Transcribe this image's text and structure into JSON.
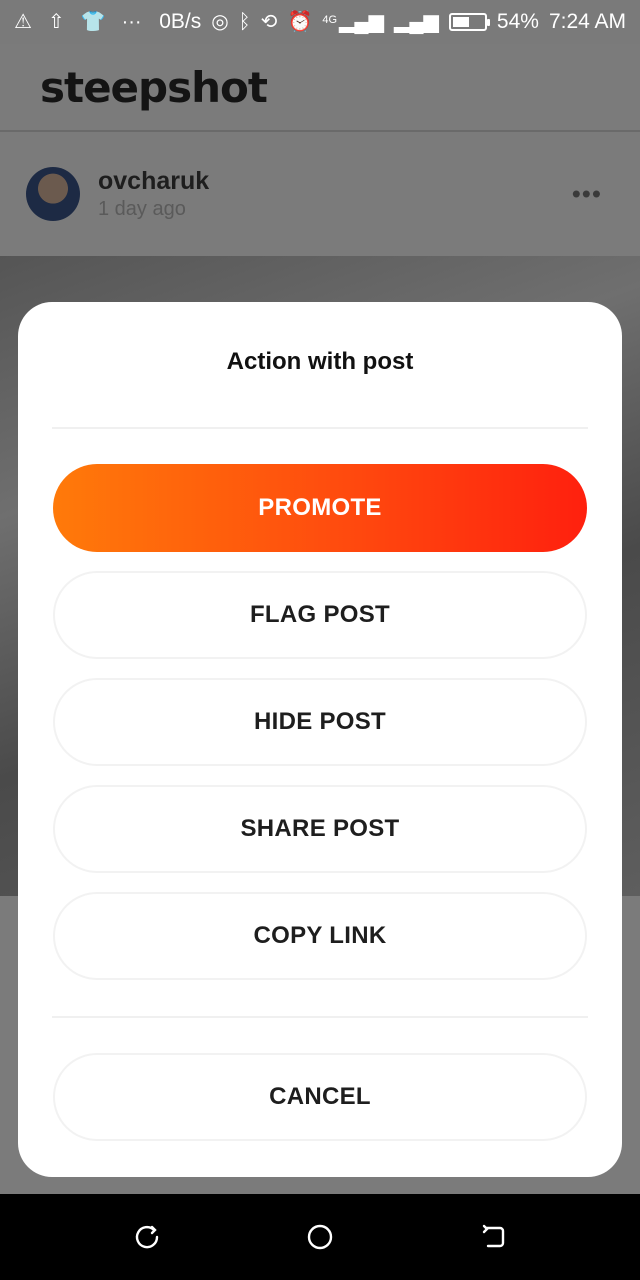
{
  "status_bar": {
    "net_speed": "0B/s",
    "network_type": "4G",
    "battery_percent": "54%",
    "battery_level": 0.54,
    "time": "7:24 AM",
    "overflow": "···"
  },
  "app": {
    "logo": "steepshot",
    "post": {
      "author": "ovcharuk",
      "time_ago": "1 day ago",
      "more_icon": "•••"
    }
  },
  "dialog": {
    "title": "Action with post",
    "buttons": {
      "promote": "PROMOTE",
      "flag": "FLAG POST",
      "hide": "HIDE POST",
      "share": "SHARE POST",
      "copy_link": "COPY LINK",
      "cancel": "CANCEL"
    },
    "accent_gradient": [
      "#ff7a0a",
      "#ff200e"
    ]
  },
  "nav_bar": {
    "icons": [
      "recent-apps-icon",
      "home-icon",
      "back-icon"
    ]
  }
}
